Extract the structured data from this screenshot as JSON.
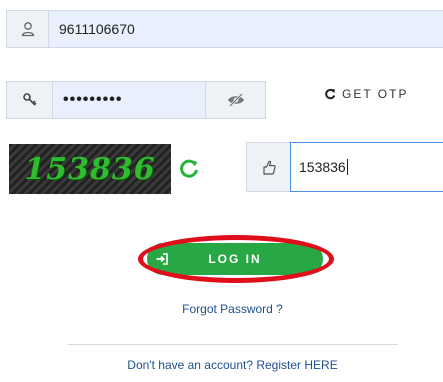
{
  "login_form": {
    "username": {
      "value": "9611106670",
      "icon": "user-icon"
    },
    "password": {
      "value": "•••••••••",
      "icon": "key-icon",
      "toggle_icon": "eye-slash-icon"
    },
    "get_otp": {
      "label": "GET OTP",
      "icon": "refresh-icon"
    },
    "captcha": {
      "image_text": "153836",
      "refresh_icon": "circular-refresh-icon",
      "input_icon": "pointing-hand-icon",
      "input_value": "153836"
    },
    "login_button": {
      "label": "LOG IN",
      "icon": "sign-in-icon",
      "color": "#28a745",
      "highlight_color": "#e00d1a"
    },
    "forgot_password": "Forgot Password ?",
    "register_link": "Don't have an account? Register HERE"
  }
}
